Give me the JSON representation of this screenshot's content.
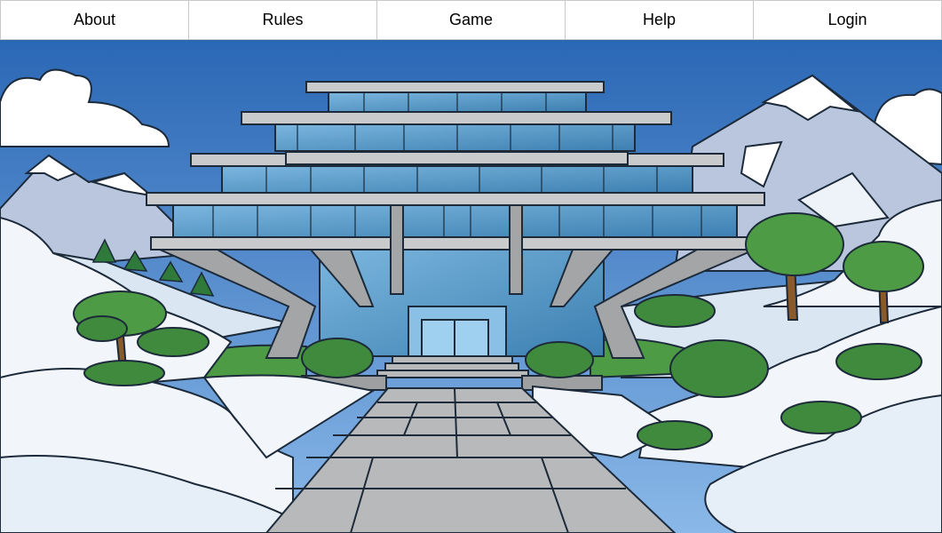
{
  "nav": {
    "items": [
      {
        "label": "About"
      },
      {
        "label": "Rules"
      },
      {
        "label": "Game"
      },
      {
        "label": "Help"
      },
      {
        "label": "Login"
      }
    ]
  },
  "colors": {
    "sky_top": "#2a67b5",
    "sky_bottom": "#7fb4e6",
    "snow": "#f2f6fb",
    "snow_shadow": "#c9d8ea",
    "glass": "#4f93c4",
    "concrete": "#a8a9aa",
    "tree": "#3f8a3c"
  },
  "scene": {
    "description_icon": "snowy-modern-building-illustration"
  }
}
